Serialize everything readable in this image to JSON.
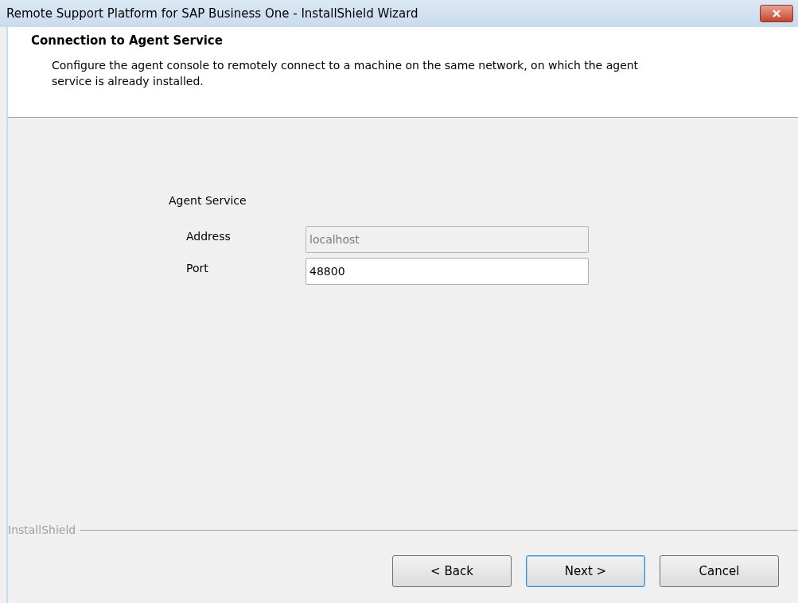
{
  "window": {
    "title": "Remote Support Platform for SAP Business One - InstallShield Wizard"
  },
  "header": {
    "title": "Connection to Agent Service",
    "description": "Configure the agent console to remotely connect to a machine on the same network, on which the agent service is already installed."
  },
  "group": {
    "label": "Agent Service",
    "fields": [
      {
        "label": "Address",
        "value": "localhost",
        "disabled": true
      },
      {
        "label": "Port",
        "value": "48800",
        "disabled": false
      }
    ]
  },
  "brand": "InstallShield",
  "buttons": [
    {
      "label": "< Back",
      "default": false
    },
    {
      "label": "Next >",
      "default": true
    },
    {
      "label": "Cancel",
      "default": false
    }
  ]
}
